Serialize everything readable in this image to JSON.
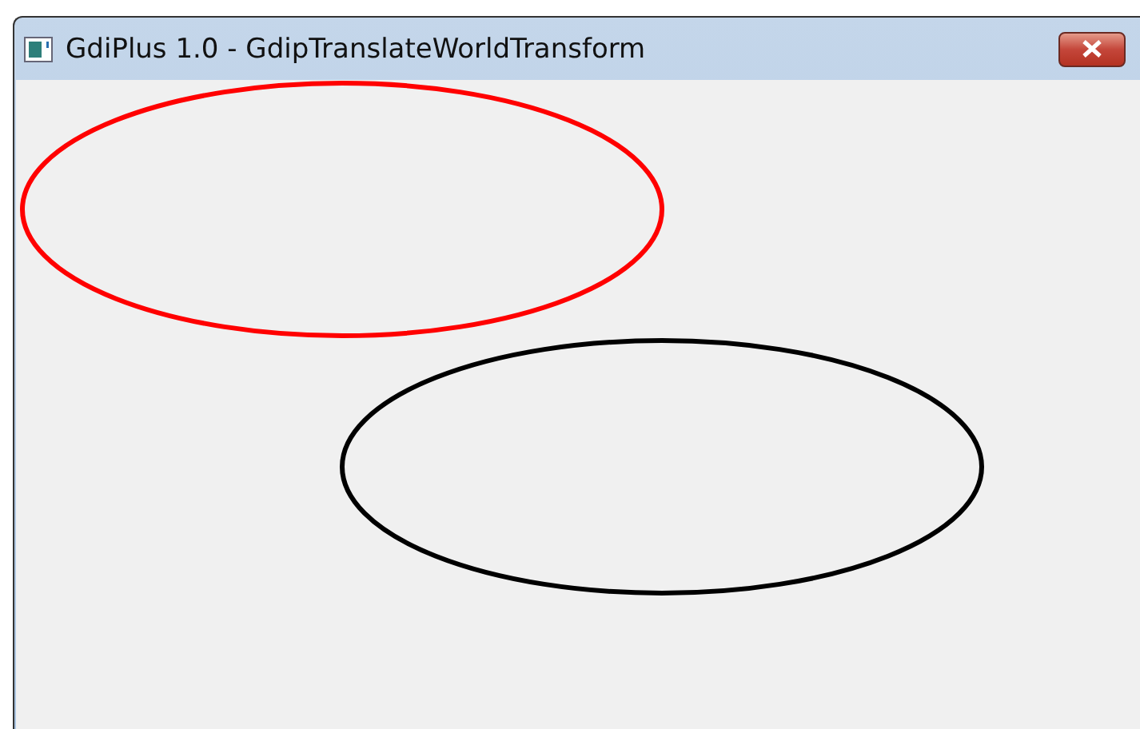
{
  "window": {
    "title": "GdiPlus 1.0 - GdipTranslateWorldTransform"
  },
  "ellipses": [
    {
      "color": "#ff0000"
    },
    {
      "color": "#000000"
    }
  ]
}
